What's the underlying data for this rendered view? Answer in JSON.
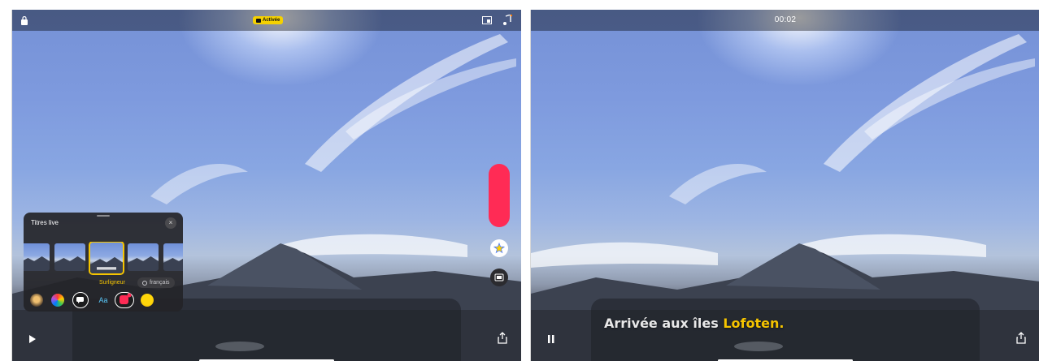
{
  "left_screen": {
    "status_badge": "Activée",
    "titles_panel": {
      "title": "Titres live",
      "close_glyph": "×",
      "selected_style": "Surligneur",
      "language": "français",
      "styles": [
        "style-1",
        "style-2",
        "surligneur",
        "style-4",
        "style-5"
      ],
      "tools": [
        "selfie-scene-icon",
        "color-filter-icon",
        "live-titles-icon",
        "text-icon",
        "stickers-icon",
        "emoji-icon"
      ],
      "tool_text_label": "Aa"
    },
    "colors": {
      "accent": "#f5c400",
      "record": "#ff2b55"
    }
  },
  "right_screen": {
    "timecode": "00:02",
    "subtitle_prefix": "Arrivée aux îles ",
    "subtitle_highlight": "Lofoten."
  }
}
